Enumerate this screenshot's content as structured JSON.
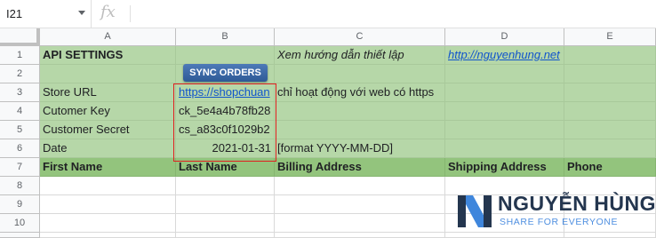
{
  "formula_bar": {
    "cell_ref": "I21",
    "fx_label": "fx",
    "value": ""
  },
  "columns": [
    "A",
    "B",
    "C",
    "D",
    "E"
  ],
  "rows": [
    "1",
    "2",
    "3",
    "4",
    "5",
    "6",
    "7",
    "8",
    "9",
    "10"
  ],
  "sheet": {
    "a1": "API SETTINGS",
    "c1": "Xem hướng dẫn thiết lập",
    "d1": "http://nguyenhung.net",
    "sync_button": "SYNC ORDERS",
    "a3": "Store URL",
    "b3": "https://shopchuan",
    "c3": "chỉ hoạt động với web có https",
    "a4": "Cutomer Key",
    "b4": "ck_5e4a4b78fb28",
    "a5": "Customer Secret",
    "b5": "cs_a83c0f1029b2",
    "a6": "Date",
    "b6": "2021-01-31",
    "c6": "[format YYYY-MM-DD]",
    "a7": "First Name",
    "b7": "Last Name",
    "c7": "Billing Address",
    "d7": "Shipping Address",
    "e7": "Phone"
  },
  "logo": {
    "name": "NGUYỄN HÙNG",
    "tagline": "SHARE FOR EVERYONE"
  },
  "colors": {
    "light_green": "#b6d7a8",
    "dark_green": "#93c47d",
    "highlight_border": "#e02020",
    "link": "#1155cc",
    "button": "#3d6aa8"
  }
}
